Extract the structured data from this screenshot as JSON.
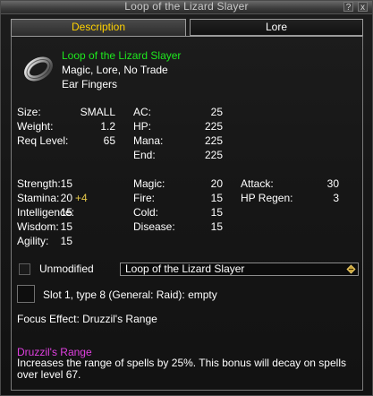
{
  "window": {
    "title": "Loop of the Lizard Slayer",
    "help_label": "?",
    "close_label": "x"
  },
  "tabs": [
    {
      "label": "Description"
    },
    {
      "label": "Lore"
    }
  ],
  "item": {
    "name": "Loop of the Lizard Slayer",
    "flags": "Magic, Lore, No Trade",
    "slots": "Ear Fingers",
    "icon": "ring-icon"
  },
  "stats_basic": [
    {
      "label": "Size:",
      "value": "SMALL"
    },
    {
      "label": "Weight:",
      "value": "1.2"
    },
    {
      "label": "Req Level:",
      "value": "65"
    }
  ],
  "stats_pool": [
    {
      "label": "AC:",
      "value": "25"
    },
    {
      "label": "HP:",
      "value": "225"
    },
    {
      "label": "Mana:",
      "value": "225"
    },
    {
      "label": "End:",
      "value": "225"
    }
  ],
  "stats_attr": [
    {
      "label": "Strength:",
      "value": "15",
      "bonus": ""
    },
    {
      "label": "Stamina:",
      "value": "20",
      "bonus": "+4"
    },
    {
      "label": "Intelligence:",
      "value": "15",
      "bonus": ""
    },
    {
      "label": "Wisdom:",
      "value": "15",
      "bonus": ""
    },
    {
      "label": "Agility:",
      "value": "15",
      "bonus": ""
    }
  ],
  "stats_resist": [
    {
      "label": "Magic:",
      "value": "20"
    },
    {
      "label": "Fire:",
      "value": "15"
    },
    {
      "label": "Cold:",
      "value": "15"
    },
    {
      "label": "Disease:",
      "value": "15"
    }
  ],
  "stats_combat": [
    {
      "label": "Attack:",
      "value": "30"
    },
    {
      "label": "HP Regen:",
      "value": "3"
    }
  ],
  "unmodified": {
    "label": "Unmodified",
    "checked": false
  },
  "dropdown": {
    "selected": "Loop of the Lizard Slayer"
  },
  "slot": {
    "text": "Slot 1, type 8 (General: Raid): empty"
  },
  "focus": {
    "text": "Focus Effect: Druzzil's Range"
  },
  "effect": {
    "name": "Druzzil's Range",
    "description": "Increases the range of spells by 25%. This bonus will decay on spells over level 67."
  },
  "colors": {
    "name": "#1ee81e",
    "active_tab": "#ffd200",
    "bonus": "#e6c84a",
    "effect_name": "#e040e0"
  }
}
